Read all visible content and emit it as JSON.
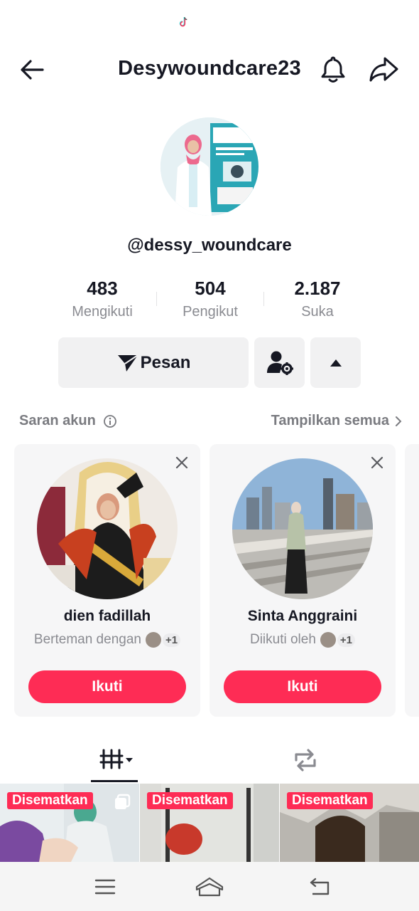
{
  "header": {
    "title": "Desywoundcare23",
    "back_icon": "back-arrow-icon",
    "bell_icon": "bell-icon",
    "share_icon": "share-icon"
  },
  "profile": {
    "username": "@dessy_woundcare",
    "stats": [
      {
        "value": "483",
        "label": "Mengikuti"
      },
      {
        "value": "504",
        "label": "Pengikut"
      },
      {
        "value": "2.187",
        "label": "Suka"
      }
    ]
  },
  "actions": {
    "message_label": "Pesan",
    "add_friend_icon": "person-settings-icon",
    "more_icon": "triangle-up-icon"
  },
  "suggestions": {
    "title": "Saran akun",
    "show_all": "Tampilkan semua",
    "cards": [
      {
        "name": "dien fadillah",
        "subtitle": "Berteman dengan",
        "extra": "+1",
        "follow_label": "Ikuti"
      },
      {
        "name": "Sinta Anggraini",
        "subtitle": "Diikuti oleh",
        "extra": "+1",
        "follow_label": "Ikuti"
      }
    ]
  },
  "tabs": {
    "videos_icon": "videos-grid-icon",
    "repost_icon": "repost-icon"
  },
  "videos": [
    {
      "badge": "Disematkan"
    },
    {
      "badge": "Disematkan"
    },
    {
      "badge": "Disematkan"
    }
  ],
  "colors": {
    "accent": "#fe2c55",
    "text": "#161823",
    "muted": "#8a8b91",
    "button_bg": "#f1f1f2"
  }
}
